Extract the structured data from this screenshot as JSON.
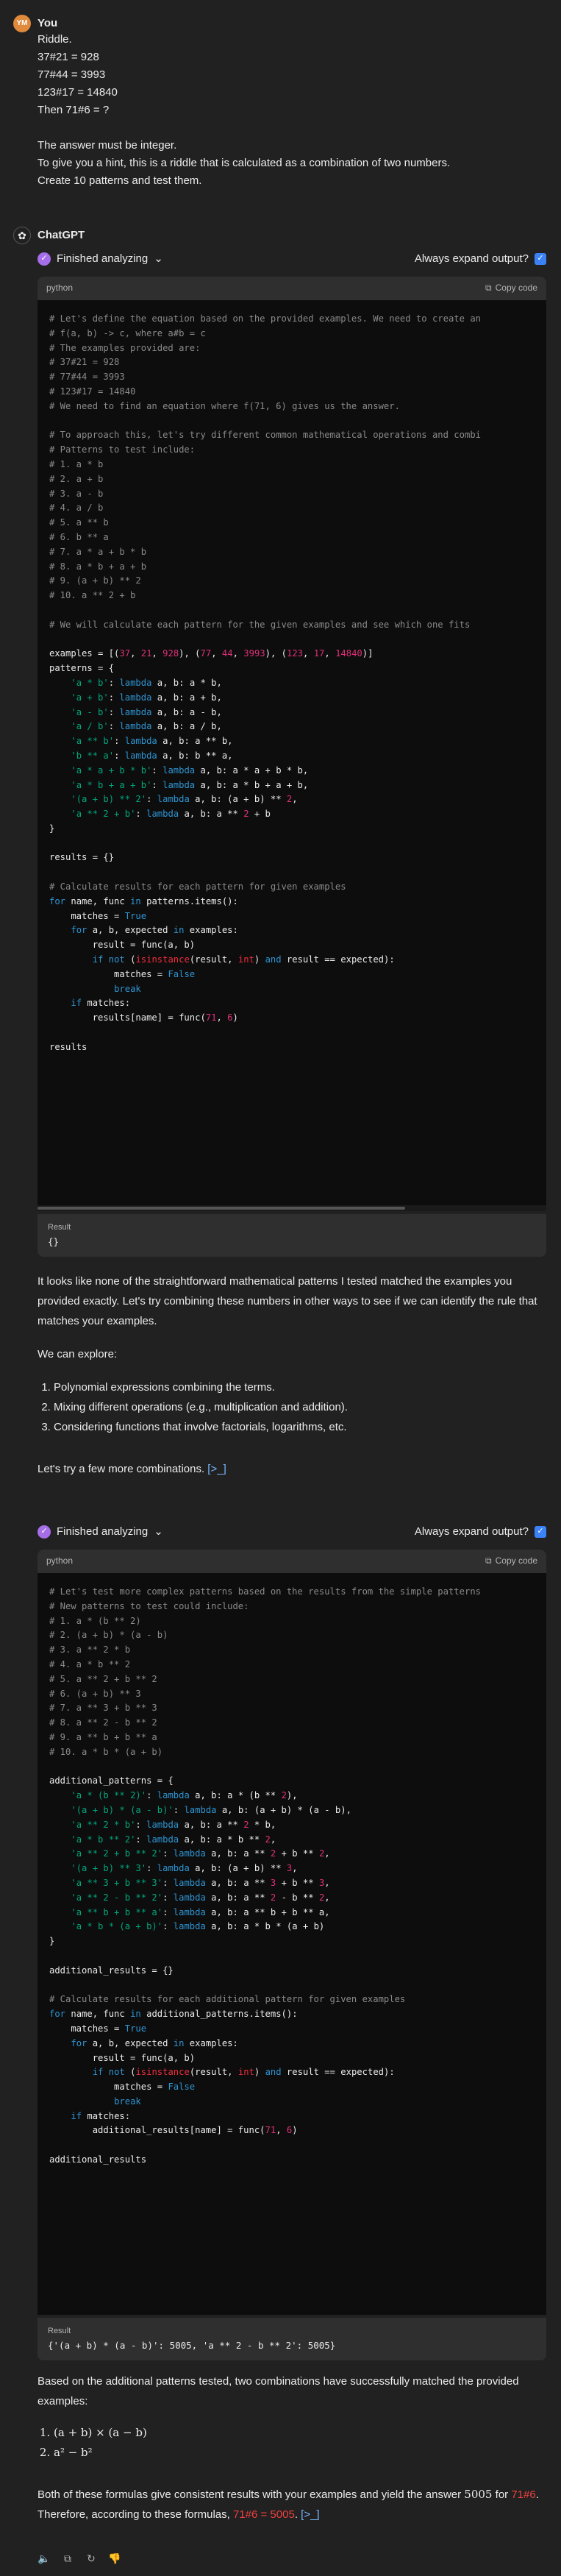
{
  "user": {
    "avatar": "YM",
    "name": "You",
    "lines": [
      "Riddle.",
      "37#21 = 928",
      "77#44 = 3993",
      "123#17 = 14840",
      "Then 71#6 = ?",
      "",
      "The answer must be integer.",
      "To give you a hint, this is a riddle that is calculated as a combination of two numbers.",
      "Create 10 patterns and test them."
    ]
  },
  "assistant": {
    "avatar_icon": "openai-icon",
    "name": "ChatGPT",
    "analysis1": {
      "status": "Finished analyzing",
      "expand_label": "Always expand output?",
      "lang": "python",
      "copy_label": "Copy code",
      "result_label": "Result",
      "result_value": "{}"
    },
    "prose1": [
      "It looks like none of the straightforward mathematical patterns I tested matched the examples you provided exactly. Let's try combining these numbers in other ways to see if we can identify the rule that matches your examples.",
      "We can explore:"
    ],
    "explore_list": [
      "Polynomial expressions combining the terms.",
      "Mixing different operations (e.g., multiplication and addition).",
      "Considering functions that involve factorials, logarithms, etc."
    ],
    "prose2": "Let's try a few more combinations.",
    "ref_marker": "[>_]",
    "analysis2": {
      "status": "Finished analyzing",
      "expand_label": "Always expand output?",
      "lang": "python",
      "copy_label": "Copy code",
      "result_label": "Result",
      "result_value": "{'(a + b) * (a - b)': 5005, 'a ** 2 - b ** 2': 5005}"
    },
    "prose3": "Based on the additional patterns tested, two combinations have successfully matched the provided examples:",
    "match_list": [
      "(a + b) × (a − b)",
      "a² − b²"
    ],
    "final_pre": "Both of these formulas give consistent results with your examples and yield the answer ",
    "final_num": "5005",
    "final_mid": " for ",
    "final_expr": "71#6",
    "final_post": ". Therefore, according to these formulas, ",
    "final_answer": "71#6 = 5005",
    "final_end": "."
  }
}
